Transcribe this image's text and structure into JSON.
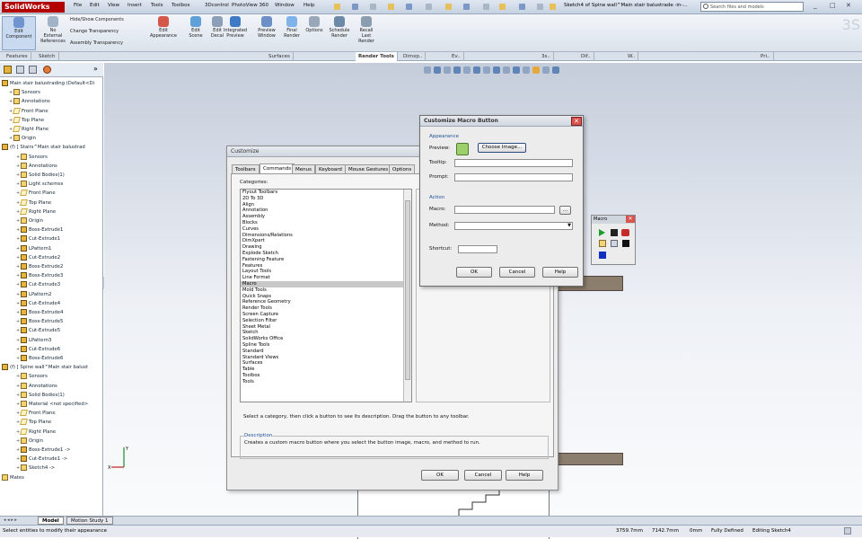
{
  "app": {
    "logo": "SolidWorks",
    "menus": [
      "File",
      "Edit",
      "View",
      "Insert",
      "Tools",
      "Toolbox",
      "3Dcontrol",
      "PhotoView 360",
      "Window",
      "Help"
    ],
    "doc_title": "Sketch4 of Spine wall^Main stair balustrade -in-...",
    "search_placeholder": "Search files and models"
  },
  "ribbon": {
    "buttons": [
      {
        "label": "Edit\nComponent",
        "x": 4
      },
      {
        "label": "No\nExternal\nReferences",
        "x": 42
      }
    ],
    "small_buttons": [
      "Hide/Show Components",
      "Change Transparency",
      "Assembly Transparency"
    ],
    "right_buttons": [
      {
        "label": "Edit\nAppearance"
      },
      {
        "label": "Edit\nScene"
      },
      {
        "label": "Edit\nDecal"
      },
      {
        "label": "Integrated\nPreview"
      },
      {
        "label": "Preview\nWindow"
      },
      {
        "label": "Final\nRender"
      },
      {
        "label": "Options"
      },
      {
        "label": "Schedule\nRender"
      },
      {
        "label": "Recall\nLast\nRender"
      }
    ]
  },
  "command_tabs": [
    "Features",
    "Sketch",
    "Surfaces",
    "Render Tools",
    "Dimxp..",
    "Ev..",
    "3s..",
    "Dif..",
    "W..",
    "Pri.."
  ],
  "tree": {
    "items": [
      {
        "label": "Main stair balustrading  (Default<Di",
        "indent": 0,
        "icon": "feat"
      },
      {
        "label": "Sensors",
        "indent": 1,
        "icon": "plain"
      },
      {
        "label": "Annotations",
        "indent": 1,
        "icon": "plain"
      },
      {
        "label": "Front Plane",
        "indent": 1,
        "icon": "plane"
      },
      {
        "label": "Top Plane",
        "indent": 1,
        "icon": "plane"
      },
      {
        "label": "Right Plane",
        "indent": 1,
        "icon": "plane"
      },
      {
        "label": "Origin",
        "indent": 1,
        "icon": "plain"
      },
      {
        "label": "(f) [ Stairs^Main stair balustrad",
        "indent": 0,
        "icon": "feat"
      },
      {
        "label": "Sensors",
        "indent": 2,
        "icon": "plain"
      },
      {
        "label": "Annotations",
        "indent": 2,
        "icon": "plain"
      },
      {
        "label": "Solid Bodies(1)",
        "indent": 2,
        "icon": "plain"
      },
      {
        "label": "Light schemes",
        "indent": 2,
        "icon": "plain"
      },
      {
        "label": "Front Plane",
        "indent": 2,
        "icon": "plane"
      },
      {
        "label": "Top Plane",
        "indent": 2,
        "icon": "plane"
      },
      {
        "label": "Right Plane",
        "indent": 2,
        "icon": "plane"
      },
      {
        "label": "Origin",
        "indent": 2,
        "icon": "plain"
      },
      {
        "label": "Boss-Extrude1",
        "indent": 2,
        "icon": "feat"
      },
      {
        "label": "Cut-Extrude1",
        "indent": 2,
        "icon": "feat"
      },
      {
        "label": "LPattern1",
        "indent": 2,
        "icon": "feat"
      },
      {
        "label": "Cut-Extrude2",
        "indent": 2,
        "icon": "feat"
      },
      {
        "label": "Boss-Extrude2",
        "indent": 2,
        "icon": "feat"
      },
      {
        "label": "Boss-Extrude3",
        "indent": 2,
        "icon": "feat"
      },
      {
        "label": "Cut-Extrude3",
        "indent": 2,
        "icon": "feat"
      },
      {
        "label": "LPattern2",
        "indent": 2,
        "icon": "feat"
      },
      {
        "label": "Cut-Extrude4",
        "indent": 2,
        "icon": "feat"
      },
      {
        "label": "Boss-Extrude4",
        "indent": 2,
        "icon": "feat"
      },
      {
        "label": "Boss-Extrude5",
        "indent": 2,
        "icon": "feat"
      },
      {
        "label": "Cut-Extrude5",
        "indent": 2,
        "icon": "feat"
      },
      {
        "label": "LPattern3",
        "indent": 2,
        "icon": "feat"
      },
      {
        "label": "Cut-Extrude6",
        "indent": 2,
        "icon": "feat"
      },
      {
        "label": "Boss-Extrude6",
        "indent": 2,
        "icon": "feat"
      },
      {
        "label": "(f) [ Spine wall^Main stair balust",
        "indent": 0,
        "icon": "feat"
      },
      {
        "label": "Sensors",
        "indent": 2,
        "icon": "plain"
      },
      {
        "label": "Annotations",
        "indent": 2,
        "icon": "plain"
      },
      {
        "label": "Solid Bodies(1)",
        "indent": 2,
        "icon": "plain"
      },
      {
        "label": "Material <not specified>",
        "indent": 2,
        "icon": "plain"
      },
      {
        "label": "Front Plane",
        "indent": 2,
        "icon": "plane"
      },
      {
        "label": "Top Plane",
        "indent": 2,
        "icon": "plane"
      },
      {
        "label": "Right Plane",
        "indent": 2,
        "icon": "plane"
      },
      {
        "label": "Origin",
        "indent": 2,
        "icon": "plain"
      },
      {
        "label": "Boss-Extrude1 ->",
        "indent": 2,
        "icon": "feat"
      },
      {
        "label": "Cut-Extrude1 ->",
        "indent": 2,
        "icon": "feat"
      },
      {
        "label": "Sketch4 ->",
        "indent": 2,
        "icon": "plain"
      },
      {
        "label": "Mates",
        "indent": 0,
        "icon": "plain"
      }
    ]
  },
  "bottom_tabs": [
    "Model",
    "Motion Study 1"
  ],
  "status": {
    "message": "Select entities to modify their appearance",
    "x": "3759.7mm",
    "y": "7142.7mm",
    "z": "0mm",
    "state": "Fully Defined",
    "editing": "Editing Sketch4"
  },
  "customize": {
    "title": "Customize",
    "tabs": [
      "Toolbars",
      "Commands",
      "Menus",
      "Keyboard",
      "Mouse Gestures",
      "Options"
    ],
    "selected_tab": "Commands",
    "categories_label": "Categories:",
    "categories": [
      "Flyout Toolbars",
      "2D To 3D",
      "Align",
      "Annotation",
      "Assembly",
      "Blocks",
      "Curves",
      "Dimensions/Relations",
      "DimXpert",
      "Drawing",
      "Explode Sketch",
      "Fastening Feature",
      "Features",
      "Layout Tools",
      "Line Format",
      "Macro",
      "Mold Tools",
      "Quick Snaps",
      "Reference Geometry",
      "Render Tools",
      "Screen Capture",
      "Selection Filter",
      "Sheet Metal",
      "Sketch",
      "SolidWorks Office",
      "Spline Tools",
      "Standard",
      "Standard Views",
      "Surfaces",
      "Table",
      "Toolbox",
      "Tools"
    ],
    "selected_category": "Macro",
    "hint": "Select a category, then click a button to see its description. Drag the button to any toolbar.",
    "description_label": "Description",
    "description": "Creates a custom macro button where you select the button image, macro, and method to run.",
    "ok": "OK",
    "cancel": "Cancel",
    "help": "Help"
  },
  "macro_dialog": {
    "title": "Customize Macro Button",
    "appearance_label": "Appearance",
    "preview_label": "Preview:",
    "choose_image": "Choose Image...",
    "tooltip_label": "Tooltip:",
    "prompt_label": "Prompt:",
    "action_label": "Action",
    "macro_label": "Macro:",
    "browse": "...",
    "method_label": "Method:",
    "shortcut_label": "Shortcut:",
    "ok": "OK",
    "cancel": "Cancel",
    "help": "Help"
  },
  "macro_toolbar": {
    "title": "Macro"
  },
  "colors": {
    "accent": "#1f4f99",
    "viewport_top": "#c5cddb",
    "close": "#d9534f"
  }
}
